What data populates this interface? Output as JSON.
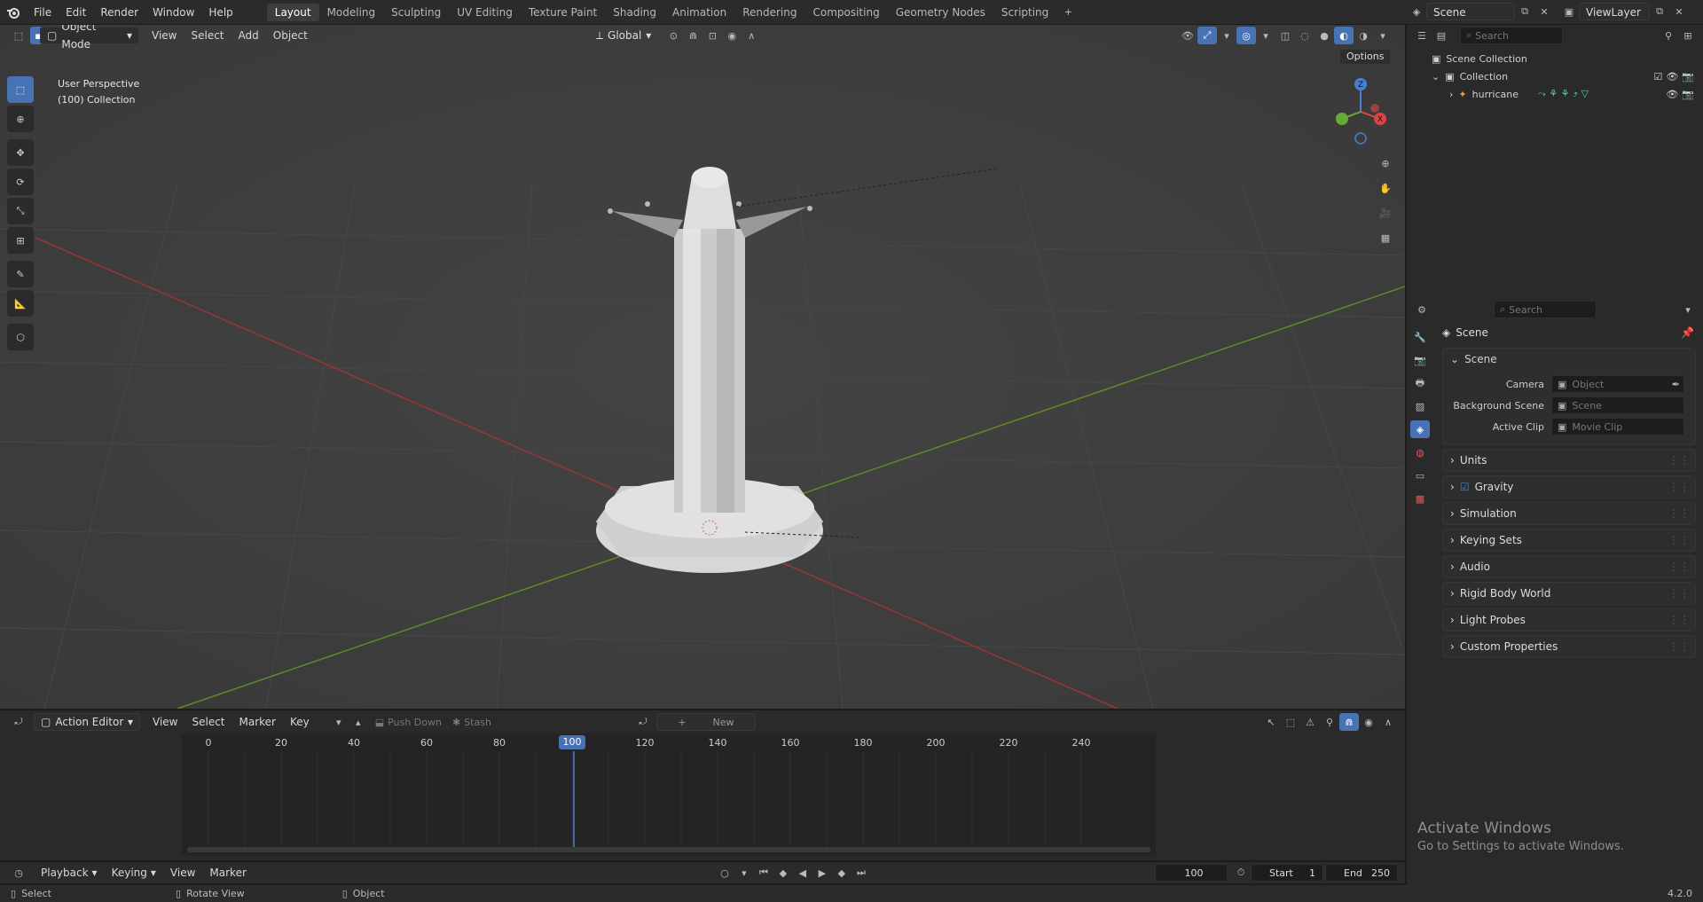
{
  "top_menu": [
    "File",
    "Edit",
    "Render",
    "Window",
    "Help"
  ],
  "workspaces": [
    {
      "label": "Layout",
      "active": true
    },
    {
      "label": "Modeling"
    },
    {
      "label": "Sculpting"
    },
    {
      "label": "UV Editing"
    },
    {
      "label": "Texture Paint"
    },
    {
      "label": "Shading"
    },
    {
      "label": "Animation"
    },
    {
      "label": "Rendering"
    },
    {
      "label": "Compositing"
    },
    {
      "label": "Geometry Nodes"
    },
    {
      "label": "Scripting"
    }
  ],
  "scene_selector": "Scene",
  "viewlayer_selector": "ViewLayer",
  "viewport": {
    "mode": "Object Mode",
    "menus": [
      "View",
      "Select",
      "Add",
      "Object"
    ],
    "transform_orientation": "Global",
    "options_label": "Options",
    "info_line1": "User Perspective",
    "info_line2": "(100) Collection",
    "gizmo_axes": {
      "x": "X",
      "y": "Y",
      "z": "Z"
    }
  },
  "outliner": {
    "search_placeholder": "Search",
    "items": [
      {
        "label": "Scene Collection"
      },
      {
        "label": "Collection"
      },
      {
        "label": "hurricane"
      }
    ]
  },
  "properties": {
    "search_placeholder": "Search",
    "breadcrumb": "Scene",
    "scene_panel": {
      "title": "Scene",
      "rows": [
        {
          "label": "Camera",
          "placeholder": "Object"
        },
        {
          "label": "Background Scene",
          "placeholder": "Scene"
        },
        {
          "label": "Active Clip",
          "placeholder": "Movie Clip"
        }
      ]
    },
    "panels": [
      "Units",
      "Gravity",
      "Simulation",
      "Keying Sets",
      "Audio",
      "Rigid Body World",
      "Light Probes",
      "Custom Properties"
    ]
  },
  "action_editor": {
    "mode": "Action Editor",
    "menus": [
      "View",
      "Select",
      "Marker",
      "Key"
    ],
    "push_down": "Push Down",
    "stash": "Stash",
    "new_label": "New",
    "ticks": [
      "0",
      "20",
      "40",
      "60",
      "80",
      "100",
      "120",
      "140",
      "160",
      "180",
      "200",
      "220",
      "240"
    ],
    "current_frame": "100"
  },
  "timeline": {
    "menus": [
      "Playback",
      "Keying",
      "View",
      "Marker"
    ],
    "frame": "100",
    "start_label": "Start",
    "start": "1",
    "end_label": "End",
    "end": "250"
  },
  "watermark": {
    "title": "Activate Windows",
    "subtitle": "Go to Settings to activate Windows."
  },
  "statusbar": {
    "items": [
      "Select",
      "Rotate View",
      "Object"
    ],
    "version": "4.2.0"
  }
}
